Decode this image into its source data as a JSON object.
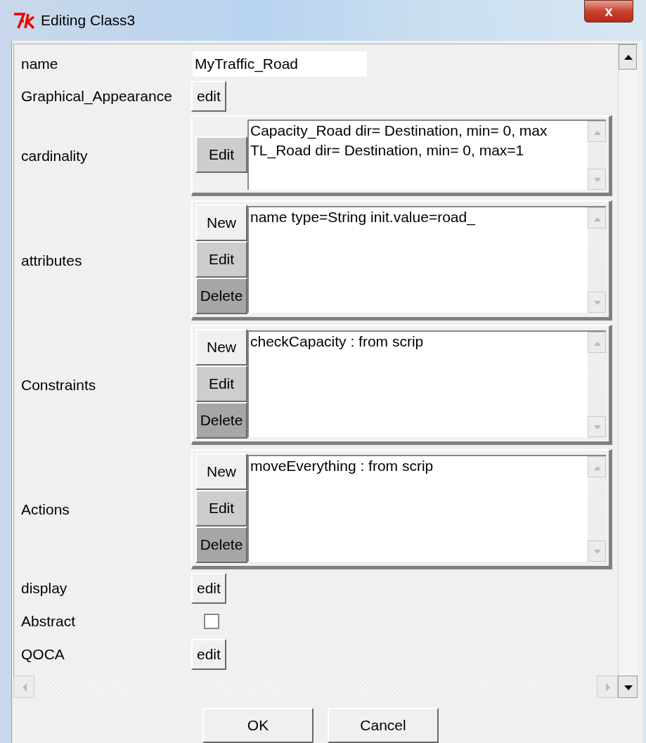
{
  "window": {
    "title": "Editing Class3",
    "close": "x"
  },
  "rows": [
    {
      "kind": "entry",
      "label": "name",
      "value": "MyTraffic_Road"
    },
    {
      "kind": "button",
      "label": "Graphical_Appearance",
      "button": "edit"
    },
    {
      "kind": "list",
      "label": "cardinality",
      "buttons": [
        {
          "label": "Edit",
          "kind": "edit"
        }
      ],
      "lines": [
        "Capacity_Road dir= Destination, min= 0, max",
        "TL_Road dir= Destination, min= 0, max=1"
      ]
    },
    {
      "kind": "list",
      "label": "attributes",
      "buttons": [
        {
          "label": "New",
          "kind": "new"
        },
        {
          "label": "Edit",
          "kind": "edit"
        },
        {
          "label": "Delete",
          "kind": "delete"
        }
      ],
      "lines": [
        "name type=String init.value=road_"
      ]
    },
    {
      "kind": "list",
      "label": "Constraints",
      "buttons": [
        {
          "label": "New",
          "kind": "new"
        },
        {
          "label": "Edit",
          "kind": "edit"
        },
        {
          "label": "Delete",
          "kind": "delete"
        }
      ],
      "lines": [
        "checkCapacity : from scrip"
      ]
    },
    {
      "kind": "list",
      "label": "Actions",
      "buttons": [
        {
          "label": "New",
          "kind": "new"
        },
        {
          "label": "Edit",
          "kind": "edit"
        },
        {
          "label": "Delete",
          "kind": "delete"
        }
      ],
      "lines": [
        "moveEverything : from scrip"
      ]
    },
    {
      "kind": "button",
      "label": "display",
      "button": "edit"
    },
    {
      "kind": "checkbox",
      "label": "Abstract",
      "checked": false
    },
    {
      "kind": "button",
      "label": "QOCA",
      "button": "edit"
    }
  ],
  "buttons": [
    "OK",
    "Cancel"
  ]
}
